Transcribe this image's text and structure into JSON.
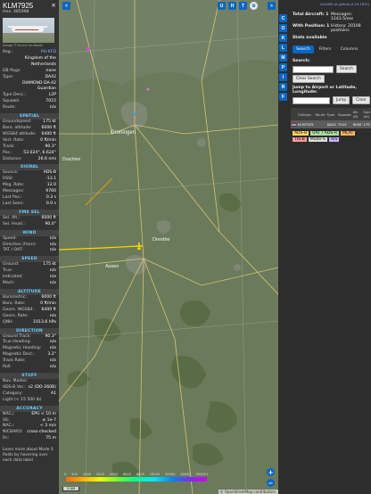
{
  "infobox": {
    "callsign": "KLM7925",
    "hex_label": "Hex:",
    "hex": "485998",
    "close": "×",
    "photo_credit": "Image © bruno mulkeeki",
    "reg_rows": [
      {
        "k": "Reg.:",
        "v": "PH-KFD"
      },
      {
        "k": "",
        "v": "Kingdom of the Netherlands"
      },
      {
        "k": "DB flags:",
        "v": "none"
      },
      {
        "k": "Type:",
        "v": "DA42"
      },
      {
        "k": "",
        "v": "DIAMOND DA-42 Guardian"
      },
      {
        "k": "Type Desc.:",
        "v": "L2P"
      },
      {
        "k": "Squawk:",
        "v": "7015"
      },
      {
        "k": "Route:",
        "v": "n/a"
      }
    ],
    "sections": [
      {
        "title": "SPATIAL",
        "rows": [
          {
            "k": "Groundspeed:",
            "v": "175 kt"
          },
          {
            "k": "Baro. altitude:",
            "v": "6000 ft"
          },
          {
            "k": "WGS84 altitude:",
            "v": "6400 ft"
          },
          {
            "k": "Vert. Rate:",
            "v": "0 ft/min"
          },
          {
            "k": "Track:",
            "v": "90.3°"
          },
          {
            "k": "Pos.:",
            "v": "53.024°, 6.624°"
          },
          {
            "k": "Distance:",
            "v": "26.6 nmi"
          }
        ]
      },
      {
        "title": "SIGNAL",
        "rows": [
          {
            "k": "Source:",
            "v": "ADS-B"
          },
          {
            "k": "RSSI:",
            "v": "-13.1"
          },
          {
            "k": "Msg. Rate:",
            "v": "12.0"
          },
          {
            "k": "Messages:",
            "v": "9760"
          },
          {
            "k": "Last Pos.:",
            "v": "0.3 s"
          },
          {
            "k": "Last Seen:",
            "v": "0.0 s"
          }
        ]
      },
      {
        "title": "FMS SEL",
        "rows": [
          {
            "k": "Sel. Alt.:",
            "v": "6000 ft"
          },
          {
            "k": "Sel. Head.:",
            "v": "90.0°"
          }
        ]
      },
      {
        "title": "WIND",
        "rows": [
          {
            "k": "Speed:",
            "v": "n/a"
          },
          {
            "k": "Direction (from):",
            "v": "n/a"
          },
          {
            "k": "TAT / OAT:",
            "v": "n/a"
          }
        ]
      },
      {
        "title": "SPEED",
        "rows": [
          {
            "k": "Ground:",
            "v": "175 kt"
          },
          {
            "k": "True:",
            "v": "n/a"
          },
          {
            "k": "Indicated:",
            "v": "n/a"
          },
          {
            "k": "Mach:",
            "v": "n/a"
          }
        ]
      },
      {
        "title": "ALTITUDE",
        "rows": [
          {
            "k": "Barometric:",
            "v": "6000 ft"
          },
          {
            "k": "Baro. Rate:",
            "v": "0 ft/min"
          },
          {
            "k": "Geom. WGS84:",
            "v": "6400 ft"
          },
          {
            "k": "Geom. Rate:",
            "v": "n/a"
          },
          {
            "k": "QNH:",
            "v": "1013.6 hPa"
          }
        ]
      },
      {
        "title": "DIRECTION",
        "rows": [
          {
            "k": "Ground Track:",
            "v": "90.3°"
          },
          {
            "k": "True Heading:",
            "v": "n/a"
          },
          {
            "k": "Magnetic Heading:",
            "v": "n/a"
          },
          {
            "k": "Magnetic Decl.:",
            "v": "3.2°"
          },
          {
            "k": "Track Rate:",
            "v": "n/a"
          },
          {
            "k": "Roll:",
            "v": "n/a"
          }
        ]
      },
      {
        "title": "STUFF",
        "rows": [
          {
            "k": "Nav. Modes:",
            "v": ""
          },
          {
            "k": "ADS-B Ver.:",
            "v": "v2 (DO-260B)"
          },
          {
            "k": "Category:",
            "v": "A1"
          },
          {
            "k": "Light (< 15 500 lb)",
            "v": ""
          }
        ]
      },
      {
        "title": "ACCURACY",
        "rows": [
          {
            "k": "NACₚ:",
            "v": "EPU < 10 m"
          },
          {
            "k": "SIL:",
            "v": "≤ 1e-7"
          },
          {
            "k": "NACᵥ:",
            "v": "< 3 m/s"
          },
          {
            "k": "NICBARO:",
            "v": "cross-checked"
          },
          {
            "k": "Rc:",
            "v": "75 m"
          }
        ]
      }
    ],
    "footnote": "Learn more about Mode S fields by hovering over each data label"
  },
  "map": {
    "place_labels": [
      "Groningen",
      "Assen",
      "Drenthe",
      "Drachten"
    ],
    "aircraft_label": "KLM7925",
    "top_buttons": [
      "U",
      "H",
      "T"
    ],
    "left_nav": [
      "<",
      ">"
    ],
    "zoom_in": "+",
    "zoom_out": "−",
    "scale": "5 NM",
    "attribution": "© OpenStreetMap contributors.",
    "legend_ticks": [
      "0",
      "500",
      "1000",
      "2000",
      "4000",
      "6000",
      "8000",
      "10000",
      "20000",
      "30000",
      "40000+"
    ]
  },
  "sidebar_buttons": [
    "C",
    "O",
    "K",
    "L",
    "M",
    "P",
    "I",
    "R",
    "F"
  ],
  "panel": {
    "top_link": "tar1090 on github (3.14.1670)",
    "stats": [
      {
        "label": "Total Aircraft: 1",
        "value": "Messages: 1243.5/sec"
      },
      {
        "label": "With Position: 1",
        "value": "History: 20108 positions"
      },
      {
        "label": "Stats available",
        "value": ""
      }
    ],
    "tabs": [
      "Search",
      "Filters",
      "Columns"
    ],
    "search_label": "Search:",
    "search_button": "Search",
    "clear_search_button": "Clear Search",
    "jump_label": "Jump to Airport or Latitude, Longitude:",
    "jump_button": "Jump",
    "clear_button": "Clear",
    "table_headers": [
      "",
      "Callsign",
      "Route",
      "Type",
      "Squawk",
      "Alt. (ft)",
      "Spd. (kt)"
    ],
    "table_rows": [
      [
        "",
        "KLM7925",
        "",
        "DA42",
        "7015",
        "6000",
        "175"
      ]
    ],
    "badges": [
      {
        "label": "ADS-B",
        "color": "#ffd966"
      },
      {
        "label": "UAT / ADS-R",
        "color": "#b0e0a0"
      },
      {
        "label": "MLAT",
        "color": "#ffb366"
      },
      {
        "label": "TIS-B",
        "color": "#ff9999"
      },
      {
        "label": "Mode-S",
        "color": "#dddddd"
      },
      {
        "label": "AIS",
        "color": "#c9b3ff"
      }
    ]
  },
  "colors": {
    "accent": "#0a66c2",
    "aircraft": "#ffd700",
    "track": "#ffd700"
  }
}
